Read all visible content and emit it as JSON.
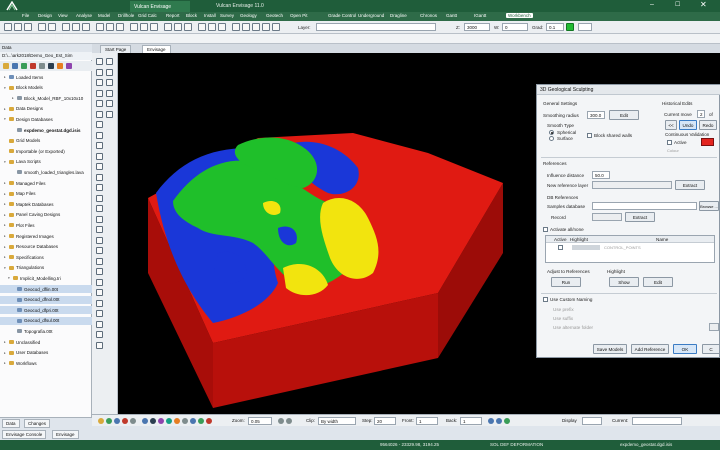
{
  "app": {
    "tab_label": "Vulcan Envisage",
    "window_title": "Vulcan Envisage 11.0",
    "accent_color": "#1f5d3a",
    "window_controls": {
      "minimize": "–",
      "maximize": "☐",
      "close": "✕"
    }
  },
  "menu": {
    "items": [
      "File",
      "Design",
      "View",
      "Analyse",
      "Model",
      "Drillhole",
      "Grid Calc",
      "Report",
      "Block",
      "Install",
      "Survey",
      "Geology",
      "Geotech",
      "Open Pit",
      "Grade Control",
      "Underground",
      "Dragline",
      "Chronos",
      "Gantt",
      "IGantt",
      "Workbench"
    ],
    "active": "Workbench"
  },
  "toolbar": {
    "layer_label": "Layer:",
    "z_label": "Z:",
    "z_value": "3000",
    "w_label": "W:",
    "w_value": "0",
    "grad_label": "Grad:",
    "grad_value": "0.1"
  },
  "left_panel": {
    "header": "Data",
    "path": "D:\\...\\ark2018\\Demo_Geo_Est_Sim",
    "tree": [
      {
        "label": "Loaded Items",
        "indent": 1,
        "icon": "blue",
        "tri": "▸"
      },
      {
        "label": "Block Models",
        "indent": 1,
        "icon": "folder",
        "tri": "▾"
      },
      {
        "label": "Block_Model_RBF_10x10x10",
        "indent": 3,
        "icon": "grey",
        "tri": "▸"
      },
      {
        "label": "Data Designs",
        "indent": 1,
        "icon": "folder",
        "tri": "▸"
      },
      {
        "label": "Design Databases",
        "indent": 1,
        "icon": "folder",
        "tri": "▾"
      },
      {
        "label": "expdemo_geostat.dgd.isis",
        "indent": 3,
        "icon": "grey",
        "tri": "",
        "bold": true
      },
      {
        "label": "Grid Models",
        "indent": 1,
        "icon": "folder",
        "tri": ""
      },
      {
        "label": "Importable (or Exported)",
        "indent": 1,
        "icon": "folder",
        "tri": ""
      },
      {
        "label": "Lava Scripts",
        "indent": 1,
        "icon": "folder",
        "tri": "▾"
      },
      {
        "label": "smooth_loaded_triangles.lava",
        "indent": 3,
        "icon": "grey",
        "tri": ""
      },
      {
        "label": "Managed Files",
        "indent": 1,
        "icon": "folder",
        "tri": "▸"
      },
      {
        "label": "Map Files",
        "indent": 1,
        "icon": "folder",
        "tri": "▸"
      },
      {
        "label": "Maptek Databases",
        "indent": 1,
        "icon": "folder",
        "tri": "▸"
      },
      {
        "label": "Panel Caving Designs",
        "indent": 1,
        "icon": "folder",
        "tri": "▸"
      },
      {
        "label": "Plot Files",
        "indent": 1,
        "icon": "folder",
        "tri": "▸"
      },
      {
        "label": "Registered Images",
        "indent": 1,
        "icon": "folder",
        "tri": "▸"
      },
      {
        "label": "Resource Databases",
        "indent": 1,
        "icon": "folder",
        "tri": "▸"
      },
      {
        "label": "Specifications",
        "indent": 1,
        "icon": "folder",
        "tri": "▸"
      },
      {
        "label": "Triangulations",
        "indent": 1,
        "icon": "folder",
        "tri": "▾"
      },
      {
        "label": "Implicit_Modelling.tri",
        "indent": 2,
        "icon": "folder",
        "tri": "▾"
      },
      {
        "label": "Geocod_dflin.00t",
        "indent": 3,
        "icon": "blue",
        "tri": "",
        "sel": true
      },
      {
        "label": "Geocod_dfnol.00t",
        "indent": 3,
        "icon": "blue",
        "tri": "",
        "sel": true
      },
      {
        "label": "Geocod_dfpri.00t",
        "indent": 3,
        "icon": "blue",
        "tri": "",
        "sel": true
      },
      {
        "label": "Geocod_dfsul.00t",
        "indent": 3,
        "icon": "blue",
        "tri": "",
        "sel": true
      },
      {
        "label": "Topografia.00t",
        "indent": 3,
        "icon": "grey",
        "tri": ""
      },
      {
        "label": "Unclassified",
        "indent": 1,
        "icon": "folder",
        "tri": "▸"
      },
      {
        "label": "User Databases",
        "indent": 1,
        "icon": "folder",
        "tri": "▸"
      },
      {
        "label": "Workflows",
        "indent": 1,
        "icon": "folder",
        "tri": "▸"
      }
    ],
    "bottom_tabs": [
      "Data",
      "Changes"
    ]
  },
  "doc_tabs": [
    "Start Page",
    "Envisage"
  ],
  "doc_tab_active": "Envisage",
  "bottom_toolbar": {
    "zoom_label": "Zoom:",
    "zoom_value": "0.05",
    "clip_label": "Clip:",
    "clip_value": "By width",
    "step_label": "Step:",
    "step_value": "20",
    "front_label": "Front:",
    "front_value": "1",
    "back_label": "Back:",
    "back_value": "1",
    "display_label": "Display",
    "current_label": "Current:"
  },
  "console_tabs": [
    "Envisage Console",
    "Envisage"
  ],
  "status": {
    "coords": "9564026 - 23329.98, 3194.25",
    "mode": "SOL DEF DEFORMATION",
    "file": "expdemo_geostat.dgd.isis"
  },
  "dialog": {
    "title": "3D Geological Sculpting",
    "general_settings": "General Settings",
    "smoothing_radius_label": "Smoothing radius",
    "smoothing_radius_value": "300.0",
    "edit_label": "Edit",
    "smooth_type_label": "Smooth Type",
    "spherical_label": "Spherical",
    "surface_label": "Surface",
    "block_shared_walls": "Block shared walls",
    "historical_edits": "Historical Edits",
    "current_move_label": "Current move",
    "current_move_value": "2",
    "of_label": "of",
    "prev_label": "<<",
    "undo_label": "Undo",
    "redo_label": "Redo",
    "continuous_validation": "Continuous Validation",
    "active_label": "Active",
    "colour_label": "Colour",
    "validation_color": "#e3241f",
    "references_label": "References",
    "influence_distance_label": "Influence distance",
    "influence_distance_value": "50.0",
    "new_reference_layer_label": "New reference layer",
    "extract_label": "Extract",
    "db_references_label": "DB References",
    "samples_database_label": "Samples database",
    "browse_label": "Browse ...",
    "record_label": "Record",
    "extract2_label": "Extract",
    "activate_all_none": "Activate all/none",
    "table_headers": [
      "Active",
      "Highlight",
      "Name"
    ],
    "table_row_name": "CONTROL_POINTS",
    "adjust_to_references": "Adjust to References",
    "highlight_label": "Highlight",
    "run_label": "Run",
    "show_label": "Show",
    "edit2_label": "Edit",
    "use_custom_naming": "Use Custom Naming",
    "use_prefix": "Use prefix",
    "use_suffix": "Use suffix",
    "use_alternate_folder": "Use alternate folder",
    "save_models": "Save Models",
    "add_reference": "Add Reference",
    "ok_label": "OK",
    "cancel_label": "C"
  },
  "model_colors": {
    "red": "#e01a12",
    "blue": "#1a37d8",
    "green": "#1fbf2a",
    "yellow": "#f2e40e",
    "dark_red": "#a80d09"
  }
}
